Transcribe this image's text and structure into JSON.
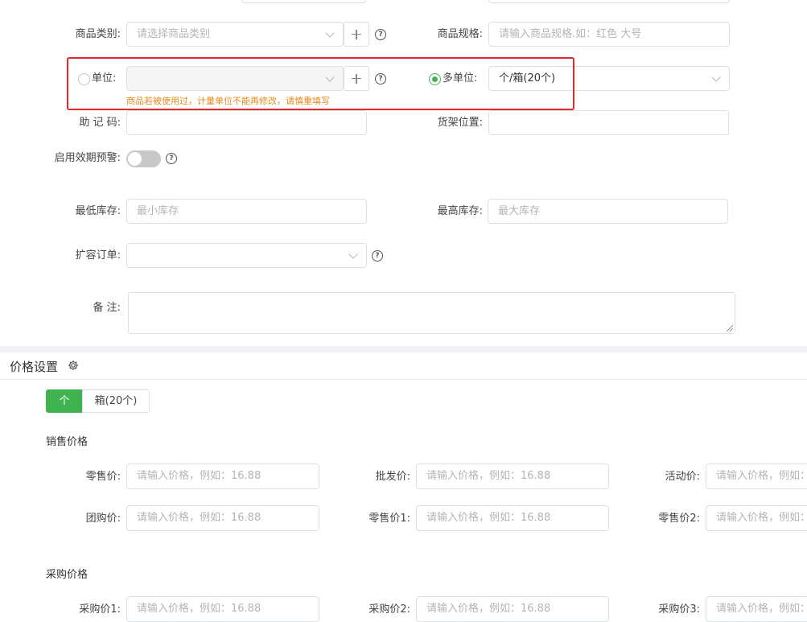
{
  "form": {
    "category": {
      "label": "商品类别:",
      "placeholder": "请选择商品类别"
    },
    "spec": {
      "label": "商品规格:",
      "placeholder": "请输入商品规格.如：红色  大号"
    },
    "unit": {
      "label": "单位:",
      "warning": "商品若被使用过，计量单位不能再修改，请慎重填写"
    },
    "multi_unit": {
      "label": "多单位:",
      "value": "个/箱(20个)"
    },
    "mnemonic": {
      "label": "助 记 码:"
    },
    "shelf": {
      "label": "货架位置:"
    },
    "expiry_alert": {
      "label": "启用效期预警:"
    },
    "min_stock": {
      "label": "最低库存:",
      "placeholder": "最小库存"
    },
    "max_stock": {
      "label": "最高库存:",
      "placeholder": "最大库存"
    },
    "expand_order": {
      "label": "扩容订单:"
    },
    "remark": {
      "label": "备 注:"
    }
  },
  "price": {
    "title": "价格设置",
    "tabs": [
      {
        "label": "个"
      },
      {
        "label": "箱(20个)"
      }
    ],
    "sale_title": "销售价格",
    "purchase_title": "采购价格",
    "placeholder": "请输入价格，例如：16.88",
    "sale_fields": [
      "零售价:",
      "批发价:",
      "活动价:",
      "团购价:",
      "零售价1:",
      "零售价2:"
    ],
    "purchase_fields": [
      "采购价1:",
      "采购价2:",
      "采购价3:"
    ]
  },
  "colors": {
    "accent": "#3fb34f",
    "warning": "#e6891a",
    "highlight": "#e02b2b"
  }
}
